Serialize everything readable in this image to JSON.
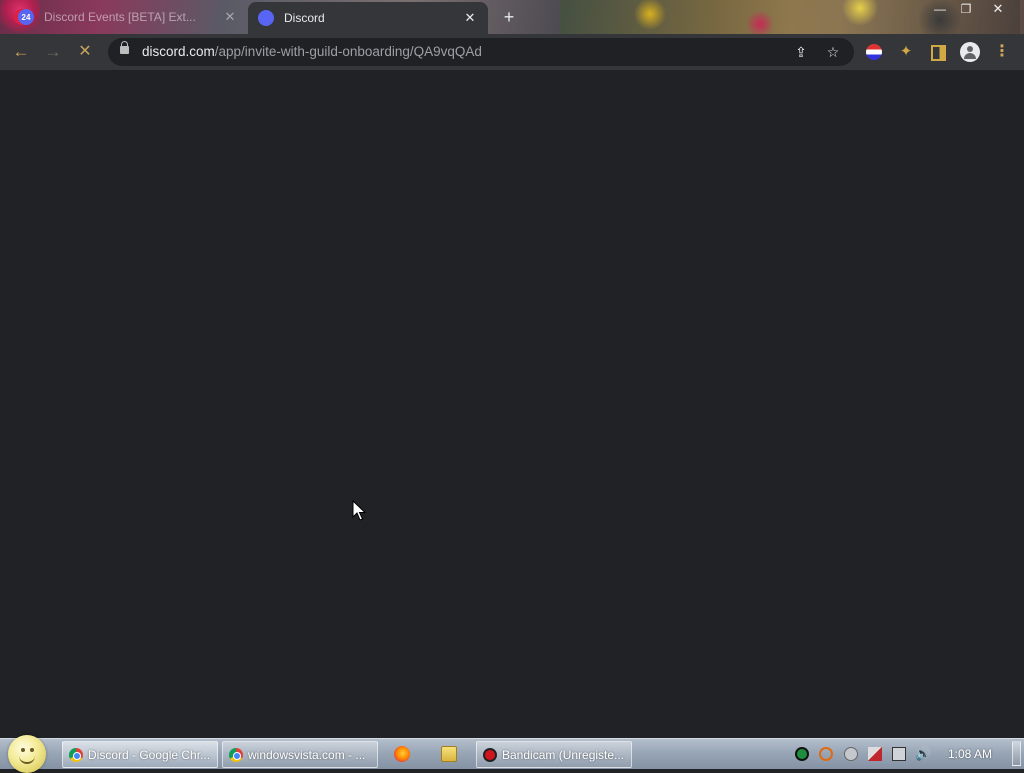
{
  "browser": {
    "tabs": [
      {
        "title": "Discord Events [BETA] Ext...",
        "favicon": "discord-events-icon",
        "badge": "24",
        "active": false
      },
      {
        "title": "Discord",
        "favicon": "discord-icon",
        "active": true
      }
    ],
    "close_glyph": "✕",
    "new_tab_glyph": "+",
    "window_controls": {
      "minimize": "—",
      "restore": "❐",
      "close": "✕"
    },
    "toolbar": {
      "back_glyph": "←",
      "forward_glyph": "→",
      "stop_glyph": "✕",
      "url_host": "discord.com",
      "url_path": "/app/invite-with-guild-onboarding/QA9vqQAd",
      "share_glyph": "⇪",
      "bookmark_glyph": "☆",
      "extensions_glyph": "✦",
      "menu_glyph": "⋮"
    }
  },
  "page": {
    "background": "#202225"
  },
  "taskbar": {
    "buttons": [
      {
        "label": "Discord - Google Chr...",
        "icon": "chrome-icon",
        "active": true
      },
      {
        "label": "windowsvista.com - ...",
        "icon": "chrome-icon",
        "active": false
      },
      {
        "label": "Bandicam (Unregiste...",
        "icon": "bandicam-icon",
        "active": false
      }
    ],
    "quick_launch": [
      "firefox-icon",
      "explorer-icon"
    ],
    "tray_icons": [
      "green-status-icon",
      "search-icon",
      "chat-icon",
      "flag-icon",
      "network-icon",
      "volume-icon"
    ],
    "volume_glyph": "🔊",
    "clock": "1:08 AM"
  }
}
